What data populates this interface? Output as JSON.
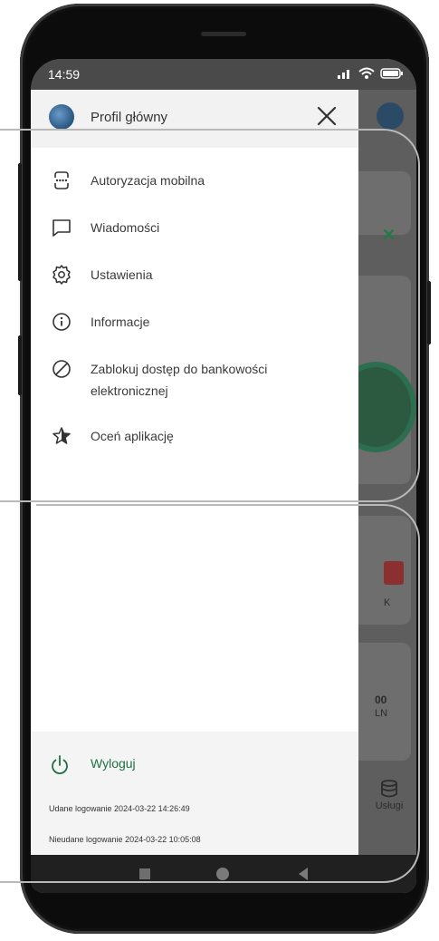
{
  "status_bar": {
    "time": "14:59"
  },
  "header": {
    "profile_name": "Profil główny"
  },
  "menu": [
    {
      "icon": "mobile-authorization-icon",
      "label": "Autoryzacja mobilna"
    },
    {
      "icon": "message-icon",
      "label": "Wiadomości"
    },
    {
      "icon": "gear-icon",
      "label": "Ustawienia"
    },
    {
      "icon": "info-icon",
      "label": "Informacje"
    },
    {
      "icon": "block-icon",
      "label": "Zablokuj dostęp do bankowości",
      "label2": "elektronicznej"
    },
    {
      "icon": "star-icon",
      "label": "Oceń aplikację"
    }
  ],
  "footer": {
    "logout_label": "Wyloguj",
    "last_login_ok": "Udane logowanie 2024-03-22 14:26:49",
    "last_login_failed": "Nieudane logowanie 2024-03-22 10:05:08"
  },
  "background": {
    "amount_fragment": "00",
    "currency_fragment": "LN",
    "icon_caption_fragment": "K",
    "services_label": "Usługi"
  },
  "colors": {
    "accent": "#1f6e43",
    "drawer_bg": "#ffffff",
    "header_bg": "#f2f2f2",
    "overlay": "#5e5e5e"
  }
}
